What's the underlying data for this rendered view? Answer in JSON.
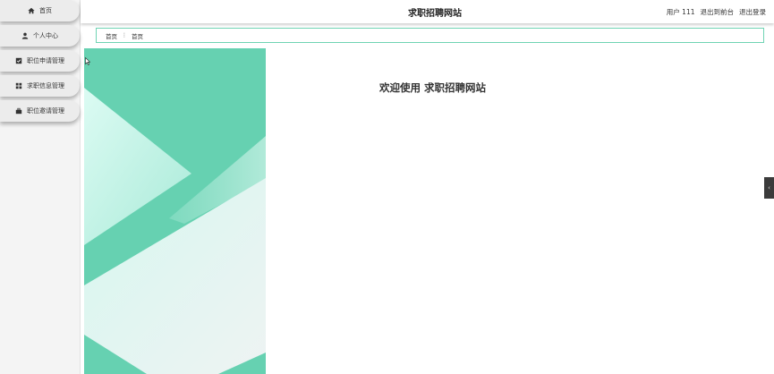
{
  "sidebar": {
    "items": [
      {
        "label": "首页",
        "icon": "home-icon"
      },
      {
        "label": "个人中心",
        "icon": "user-icon"
      },
      {
        "label": "职位申请管理",
        "icon": "checkbox-icon"
      },
      {
        "label": "求职信息管理",
        "icon": "grid-icon"
      },
      {
        "label": "职位邀请管理",
        "icon": "briefcase-icon"
      }
    ]
  },
  "header": {
    "title": "求职招聘网站",
    "user_label": "用户 111",
    "back_link": "退出到前台",
    "logout_link": "退出登录"
  },
  "breadcrumb": {
    "home": "首页",
    "current": "首页"
  },
  "main": {
    "welcome": "欢迎使用 求职招聘网站"
  },
  "colors": {
    "accent": "#6fd3b3",
    "deco_green": "#66d1b1",
    "deco_light": "#d2f4ec",
    "edge_tab": "#3b3b3b"
  }
}
